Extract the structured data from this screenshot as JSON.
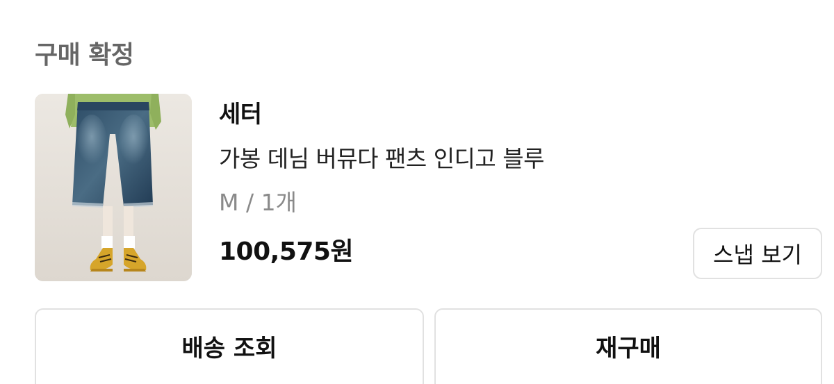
{
  "order": {
    "status_title": "구매 확정"
  },
  "product": {
    "image_icon": "product-photo-denim-shorts",
    "brand": "세터",
    "name": "가봉 데님 버뮤다 팬츠 인디고 블루",
    "option": "M / 1개",
    "price": "100,575원"
  },
  "buttons": {
    "snap": "스냅 보기",
    "track_delivery": "배송 조회",
    "rebuy": "재구매"
  },
  "colors": {
    "border": "#e1e1e1",
    "title_gray": "#666666",
    "option_gray": "#8a8a8a"
  }
}
